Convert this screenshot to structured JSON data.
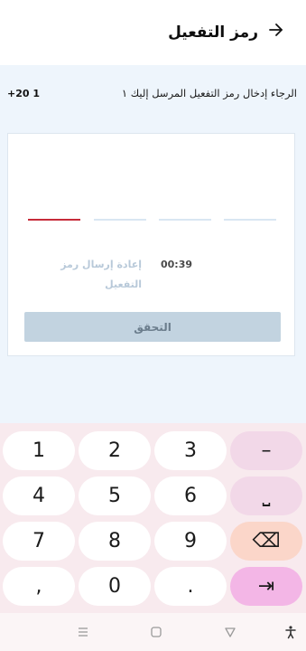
{
  "header": {
    "title": "رمز التفعيل",
    "back_icon": "arrow-right-icon"
  },
  "instructions": {
    "message": "الرجاء إدخال رمز التفعيل المرسل إليك ١",
    "phone": "+20 1"
  },
  "otp": {
    "slots": [
      "",
      "",
      "",
      ""
    ],
    "active_index": 0,
    "active_color": "#c62b3a"
  },
  "timer": "00:39",
  "resend_label": "إعادة إرسال رمز التفعيل",
  "verify_label": "التحقق",
  "keypad": {
    "rows": [
      [
        "1",
        "2",
        "3",
        "–"
      ],
      [
        "4",
        "5",
        "6",
        "⎵"
      ],
      [
        "7",
        "8",
        "9",
        "⌫"
      ],
      [
        ",",
        "0",
        ".",
        "⇥"
      ]
    ]
  },
  "navbar": {
    "icons": [
      "menu-icon",
      "home-icon",
      "back-icon",
      "accessibility-icon"
    ]
  }
}
